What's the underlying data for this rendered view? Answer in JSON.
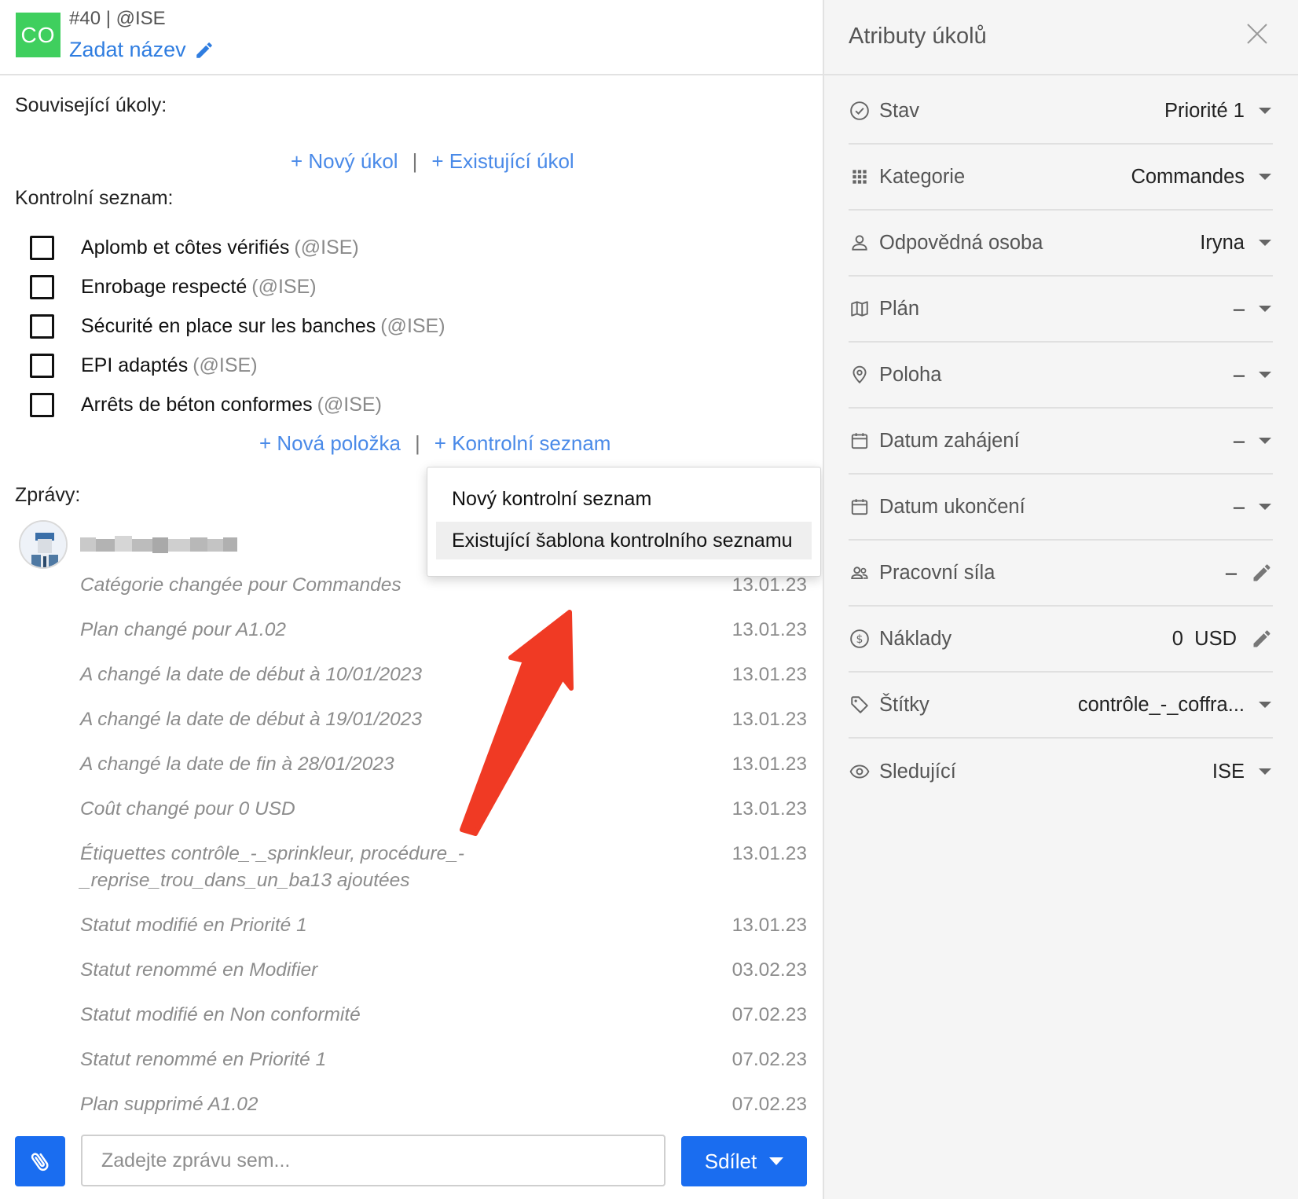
{
  "task": {
    "badge": "CO",
    "meta": "#40 | @ISE",
    "title_placeholder": "Zadat název"
  },
  "related": {
    "label": "Související úkoly:",
    "new_task": "+ Nový úkol",
    "separator": "|",
    "existing_task": "+ Existující úkol"
  },
  "checklist": {
    "label": "Kontrolní seznam:",
    "items": [
      {
        "text": "Aplomb et côtes vérifiés",
        "user": "(@ISE)"
      },
      {
        "text": "Enrobage respecté",
        "user": "(@ISE)"
      },
      {
        "text": "Sécurité en place sur les banches",
        "user": "(@ISE)"
      },
      {
        "text": "EPI adaptés",
        "user": "(@ISE)"
      },
      {
        "text": "Arrêts de béton conformes",
        "user": "(@ISE)"
      }
    ],
    "new_item": "+ Nová položka",
    "separator": "|",
    "add_checklist": "+ Kontrolní seznam"
  },
  "dropdown": {
    "items": [
      "Nový kontrolní seznam",
      "Existující šablona kontrolního seznamu"
    ]
  },
  "messages": {
    "label": "Zprávy:",
    "items": [
      {
        "text": "Catégorie changée pour Commandes",
        "date": "13.01.23"
      },
      {
        "text": "Plan changé pour A1.02",
        "date": "13.01.23"
      },
      {
        "text": "A changé la date de début à 10/01/2023",
        "date": "13.01.23"
      },
      {
        "text": "A changé la date de début à 19/01/2023",
        "date": "13.01.23"
      },
      {
        "text": "A changé la date de fin à 28/01/2023",
        "date": "13.01.23"
      },
      {
        "text": "Coût changé pour 0 USD",
        "date": "13.01.23"
      },
      {
        "text": "Étiquettes contrôle_-_sprinkleur, procédure_-_reprise_trou_dans_un_ba13 ajoutées",
        "date": "13.01.23"
      },
      {
        "text": "Statut modifié en Priorité 1",
        "date": "13.01.23"
      },
      {
        "text": "Statut renommé en Modifier",
        "date": "03.02.23"
      },
      {
        "text": "Statut modifié en Non conformité",
        "date": "07.02.23"
      },
      {
        "text": "Statut renommé en Priorité 1",
        "date": "07.02.23"
      },
      {
        "text": "Plan supprimé A1.02",
        "date": "07.02.23"
      }
    ]
  },
  "composer": {
    "placeholder": "Zadejte zprávu sem...",
    "share_label": "Sdílet"
  },
  "attributes": {
    "title": "Atributy úkolů",
    "rows": [
      {
        "icon": "status-check-icon",
        "label": "Stav",
        "value": "Priorité 1",
        "control": "dropdown"
      },
      {
        "icon": "grid-icon",
        "label": "Kategorie",
        "value": "Commandes",
        "control": "dropdown"
      },
      {
        "icon": "person-icon",
        "label": "Odpovědná osoba",
        "value": "Iryna",
        "control": "dropdown"
      },
      {
        "icon": "map-icon",
        "label": "Plán",
        "value": "–",
        "control": "dropdown"
      },
      {
        "icon": "location-pin-icon",
        "label": "Poloha",
        "value": "–",
        "control": "dropdown"
      },
      {
        "icon": "calendar-icon",
        "label": "Datum zahájení",
        "value": "–",
        "control": "dropdown"
      },
      {
        "icon": "calendar-icon",
        "label": "Datum ukončení",
        "value": "–",
        "control": "dropdown"
      },
      {
        "icon": "people-icon",
        "label": "Pracovní síla",
        "value": "–",
        "control": "edit"
      },
      {
        "icon": "dollar-icon",
        "label": "Náklady",
        "value": "0  USD",
        "control": "edit"
      },
      {
        "icon": "tag-icon",
        "label": "Štítky",
        "value": "contrôle_-_coffra...",
        "control": "dropdown"
      },
      {
        "icon": "eye-icon",
        "label": "Sledující",
        "value": "ISE",
        "control": "dropdown"
      }
    ]
  },
  "colors": {
    "accent": "#1a6df0",
    "link": "#4a8ae8",
    "badge": "#3fcf5e",
    "annotation_arrow": "#f03a24"
  }
}
